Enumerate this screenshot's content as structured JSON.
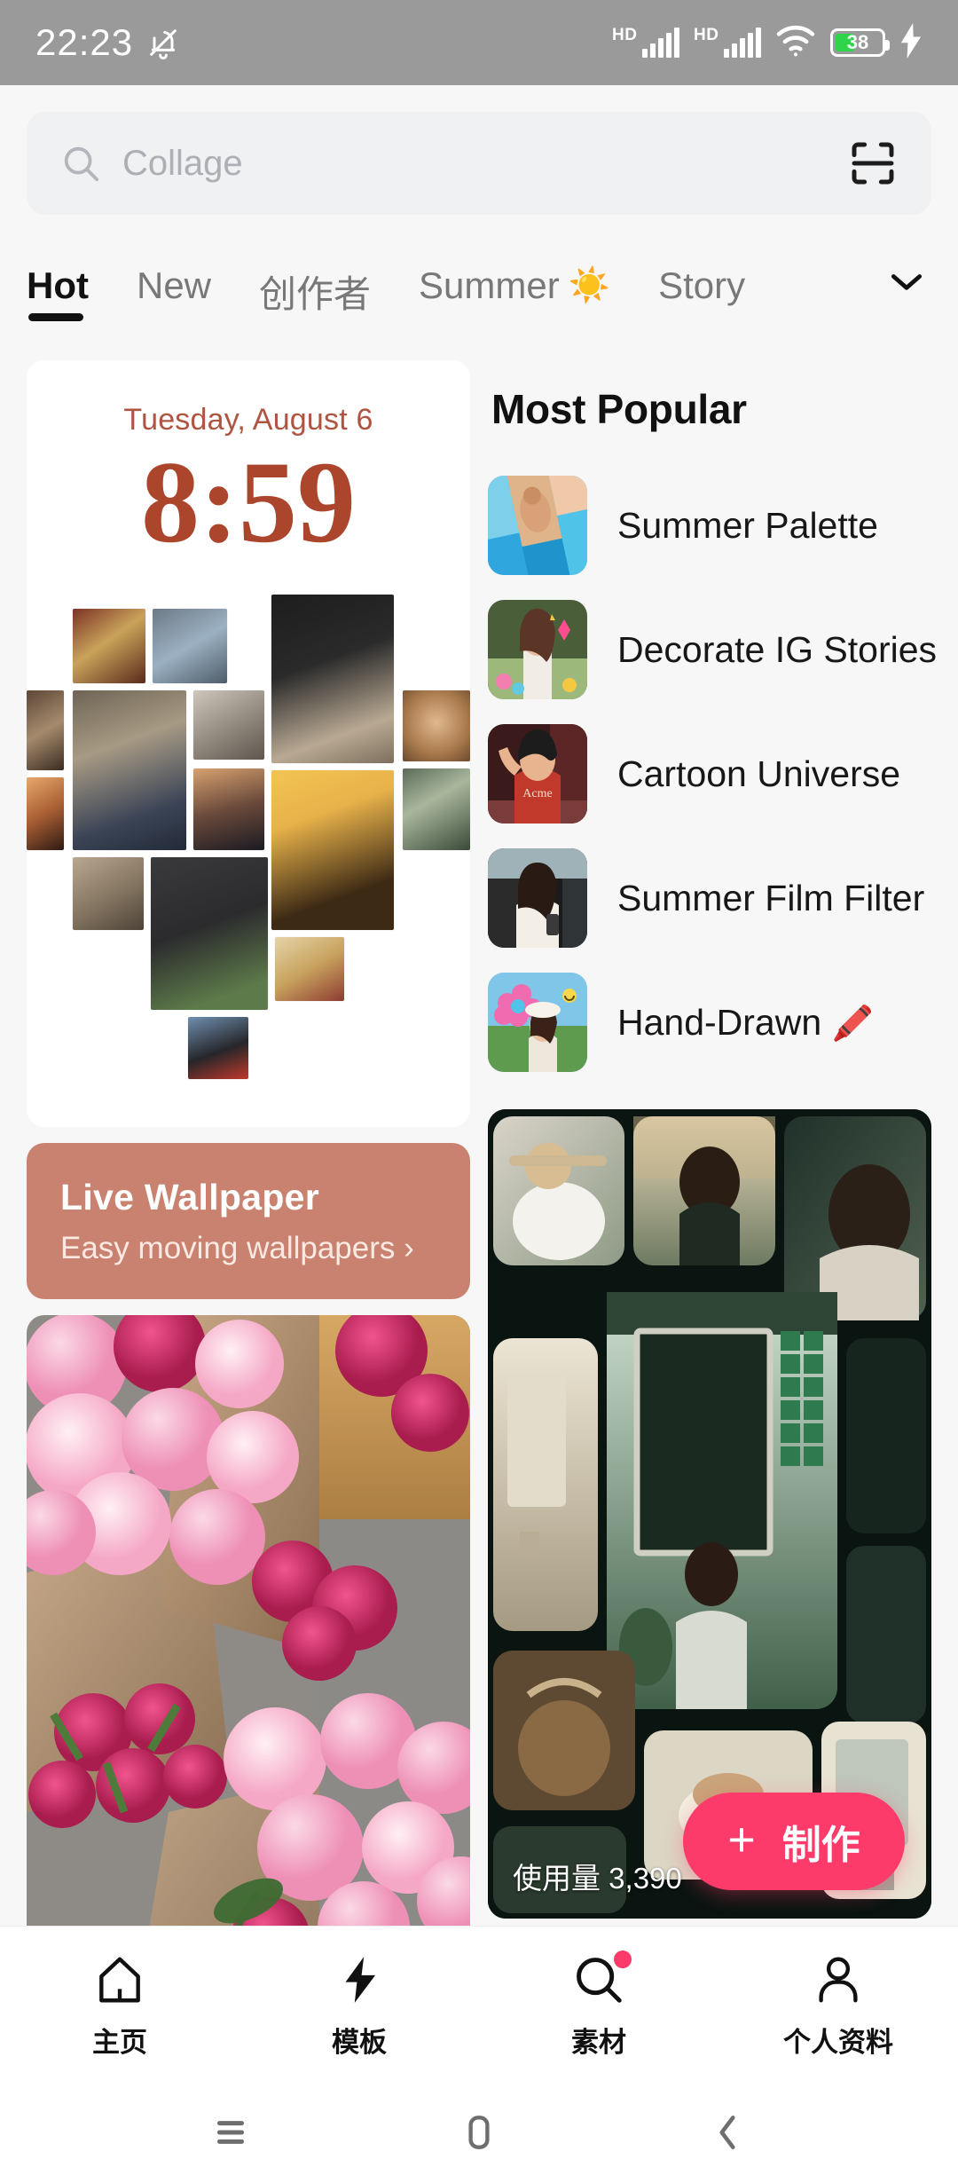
{
  "status_bar": {
    "time": "22:23",
    "bell_icon": "bell-muted-icon",
    "signal1_label": "HD",
    "signal2_label": "HD",
    "wifi_icon": "wifi-icon",
    "battery_percent": "38",
    "charging_icon": "charging-bolt-icon",
    "battery_color": "#2ED54B"
  },
  "search": {
    "placeholder": "Collage",
    "search_icon": "search-icon",
    "scan_icon": "scan-frame-icon"
  },
  "tabs": {
    "items": [
      {
        "label": "Hot",
        "active": true
      },
      {
        "label": "New",
        "active": false
      },
      {
        "label": "创作者",
        "active": false
      },
      {
        "label": "Summer",
        "emoji": "☀️",
        "active": false
      },
      {
        "label": "Story",
        "active": false
      }
    ],
    "expand_icon": "chevron-down-icon"
  },
  "clock_widget": {
    "date": "Tuesday, August 6",
    "time": "8:59",
    "accent_color": "#AB452C"
  },
  "live_wallpaper_banner": {
    "title": "Live Wallpaper",
    "subtitle": "Easy moving wallpapers",
    "arrow": "›",
    "background_color": "#C9826F"
  },
  "most_popular": {
    "heading": "Most Popular",
    "items": [
      {
        "label": "Summer Palette",
        "emoji": ""
      },
      {
        "label": "Decorate IG Stories",
        "emoji": ""
      },
      {
        "label": "Cartoon Universe",
        "emoji": ""
      },
      {
        "label": "Summer Film Filter",
        "emoji": ""
      },
      {
        "label": "Hand-Drawn",
        "emoji": "🖍️"
      }
    ]
  },
  "dark_collage_card": {
    "usage_label": "使用量 3,390"
  },
  "fab": {
    "plus": "+",
    "label": "制作",
    "color": "#FC3B6B"
  },
  "bottom_nav": {
    "items": [
      {
        "label": "主页",
        "icon": "home-icon",
        "badge": false
      },
      {
        "label": "模板",
        "icon": "lightning-icon",
        "badge": false
      },
      {
        "label": "素材",
        "icon": "search-icon",
        "badge": true
      },
      {
        "label": "个人资料",
        "icon": "person-icon",
        "badge": false
      }
    ]
  },
  "system_nav": {
    "recents": "recents-icon",
    "home": "home-square-icon",
    "back": "back-chevron-icon"
  }
}
